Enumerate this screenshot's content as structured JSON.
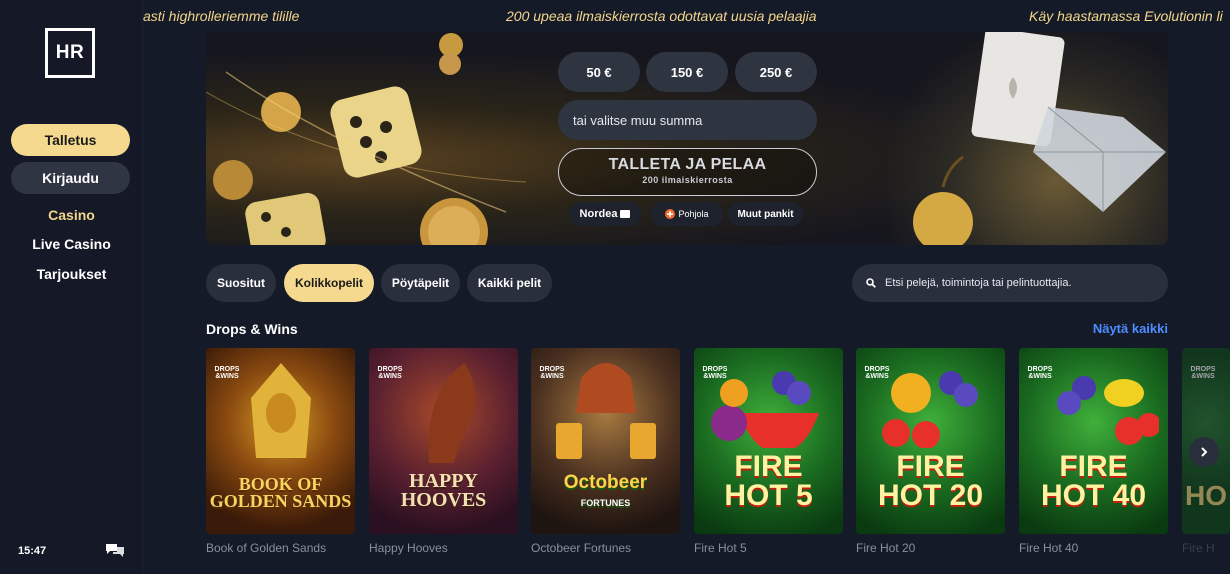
{
  "sidebar": {
    "logo": "HR",
    "deposit_label": "Talletus",
    "login_label": "Kirjaudu",
    "nav": [
      "Casino",
      "Live Casino",
      "Tarjoukset"
    ],
    "clock": "15:47"
  },
  "marquee": [
    "asti highrolleriemme tilille",
    "200 upeaa ilmaiskierrosta odottavat uusia pelaajia",
    "Käy haastamassa Evolutionin li"
  ],
  "hero": {
    "amounts": [
      "50 €",
      "150 €",
      "250 €"
    ],
    "custom_placeholder": "tai valitse muu summa",
    "cta_label": "TALLETA JA PELAA",
    "cta_sub": "200 ilmaiskierrosta",
    "banks": [
      "Nordea",
      "Pohjola",
      "Muut pankit"
    ]
  },
  "filters": [
    "Suositut",
    "Kolikkopelit",
    "Pöytäpelit",
    "Kaikki pelit"
  ],
  "active_filter": "Kolikkopelit",
  "search_placeholder": "Etsi pelejä, toimintoja tai pelintuottajia.",
  "section": {
    "title": "Drops & Wins",
    "see_all": "Näytä kaikki"
  },
  "badge_text": [
    "DROPS",
    "&WINS"
  ],
  "games": [
    {
      "name": "Book of Golden Sands",
      "art": [
        "BOOK OF",
        "GOLDEN SANDS"
      ]
    },
    {
      "name": "Happy Hooves",
      "art": [
        "HAPPY",
        "HOOVES"
      ]
    },
    {
      "name": "Octobeer Fortunes",
      "art": [
        "Octobeer",
        "FORTUNES"
      ]
    },
    {
      "name": "Fire Hot 5",
      "art": [
        "FIRE",
        "HOT 5"
      ]
    },
    {
      "name": "Fire Hot 20",
      "art": [
        "FIRE",
        "HOT 20"
      ]
    },
    {
      "name": "Fire Hot 40",
      "art": [
        "FIRE",
        "HOT 40"
      ]
    },
    {
      "name": "Fire H",
      "art": [
        "HO"
      ]
    }
  ],
  "colors": {
    "accent": "#f5d98f",
    "link": "#4c8dff",
    "background": "#151a28"
  }
}
